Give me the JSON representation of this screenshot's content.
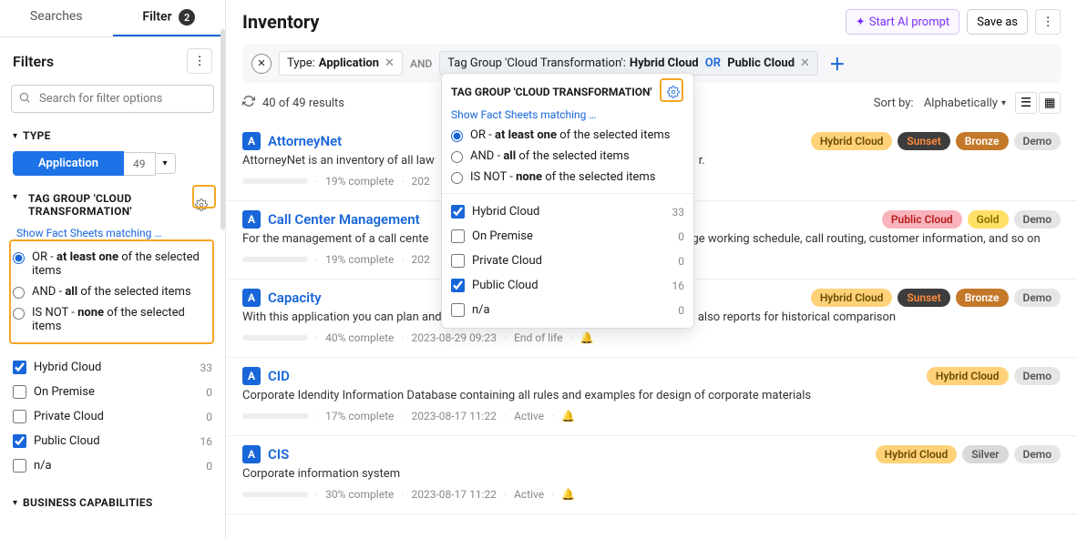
{
  "sidebar": {
    "tabs": {
      "searches": "Searches",
      "filter": "Filter",
      "filter_count": "2"
    },
    "filters_title": "Filters",
    "search_placeholder": "Search for filter options",
    "type": {
      "label": "TYPE",
      "chip": "Application",
      "count": "49"
    },
    "taggroup": {
      "label": "TAG GROUP 'CLOUD TRANSFORMATION'",
      "show_link": "Show Fact Sheets matching …",
      "options": {
        "or_pre": "OR - ",
        "or_bold": "at least one",
        "or_post": " of the selected items",
        "and_pre": "AND - ",
        "and_bold": "all",
        "and_post": " of the selected items",
        "isnot_pre": "IS NOT - ",
        "isnot_bold": "none",
        "isnot_post": " of the selected items"
      },
      "items": [
        {
          "label": "Hybrid Cloud",
          "count": "33",
          "checked": true
        },
        {
          "label": "On Premise",
          "count": "0",
          "checked": false
        },
        {
          "label": "Private Cloud",
          "count": "0",
          "checked": false
        },
        {
          "label": "Public Cloud",
          "count": "16",
          "checked": true
        },
        {
          "label": "n/a",
          "count": "0",
          "checked": false
        }
      ]
    },
    "bizcap": "BUSINESS CAPABILITIES"
  },
  "main": {
    "title": "Inventory",
    "ai_btn": "Start AI prompt",
    "save_as": "Save as",
    "filterbar": {
      "type_label": "Type: ",
      "type_value": "Application",
      "and": "AND",
      "taggroup_label": "Tag Group 'Cloud Transformation': ",
      "tag1": "Hybrid Cloud",
      "or": "OR",
      "tag2": "Public Cloud"
    },
    "results": "40 of 49 results",
    "sort_label": "Sort by:",
    "sort_value": "Alphabetically",
    "items": [
      {
        "name": "AttorneyNet",
        "desc": "AttorneyNet is an inventory of all law",
        "pct": "19% complete",
        "date": "202",
        "tags": [
          "hybrid",
          "sunset",
          "bronze",
          "demo"
        ],
        "tag_labels": [
          "Hybrid Cloud",
          "Sunset",
          "Bronze",
          "Demo"
        ]
      },
      {
        "name": "Call Center Management",
        "desc": "For the management of a call cente",
        "desc2": "age working schedule, call routing, customer information, and so on",
        "pct": "19% complete",
        "date": "202",
        "tags": [
          "public",
          "gold",
          "demo"
        ],
        "tag_labels": [
          "Public Cloud",
          "Gold",
          "Demo"
        ]
      },
      {
        "name": "Capacity",
        "desc": "With this application you can plan and track the production capacity. This app includes also reports for historical comparison",
        "pct": "40% complete",
        "date": "2023-08-29 09:23",
        "status": "End of life",
        "tags": [
          "hybrid",
          "sunset",
          "bronze",
          "demo"
        ],
        "tag_labels": [
          "Hybrid Cloud",
          "Sunset",
          "Bronze",
          "Demo"
        ]
      },
      {
        "name": "CID",
        "desc": "Corporate Idendity Information Database containing all rules and examples for design of corporate materials",
        "pct": "17% complete",
        "date": "2023-08-17 11:22",
        "status": "Active",
        "tags": [
          "hybrid",
          "demo"
        ],
        "tag_labels": [
          "Hybrid Cloud",
          "Demo"
        ]
      },
      {
        "name": "CIS",
        "desc": "Corporate information system",
        "pct": "30% complete",
        "date": "2023-08-17 11:22",
        "status": "Active",
        "tags": [
          "hybrid",
          "silver",
          "demo"
        ],
        "tag_labels": [
          "Hybrid Cloud",
          "Silver",
          "Demo"
        ]
      }
    ]
  },
  "popover": {
    "title": "TAG GROUP 'CLOUD TRANSFORMATION'",
    "show_link": "Show Fact Sheets matching …"
  },
  "type_letter": "A"
}
